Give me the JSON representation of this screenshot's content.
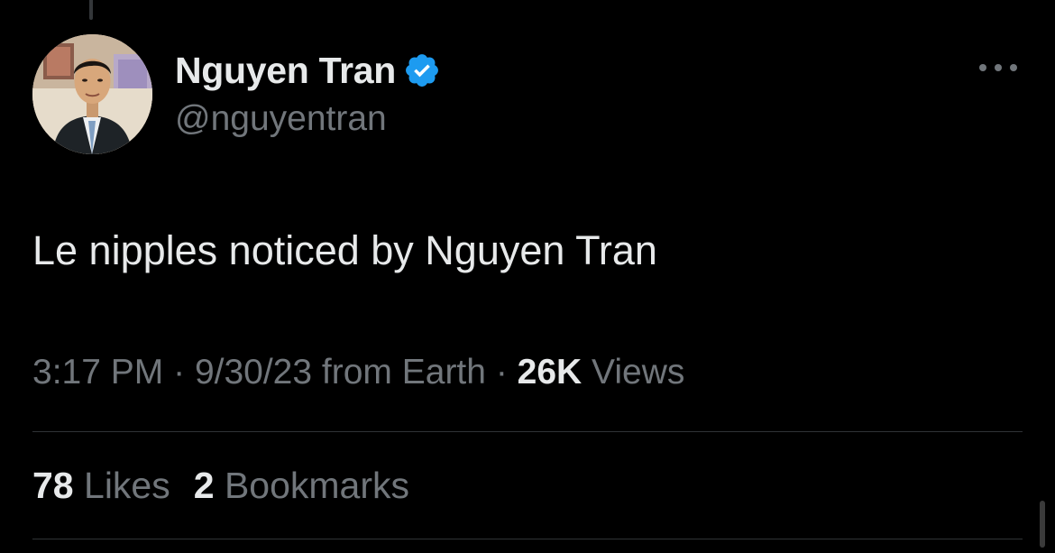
{
  "author": {
    "display_name": "Nguyen Tran",
    "handle": "@nguyentran",
    "verified": true,
    "verified_badge_color": "#1d9bf0"
  },
  "tweet": {
    "text": "Le nipples noticed by Nguyen Tran"
  },
  "meta": {
    "time": "3:17 PM",
    "separator": "·",
    "date": "9/30/23",
    "source": "from Earth",
    "views_count": "26K",
    "views_label": "Views"
  },
  "stats": {
    "likes_count": "78",
    "likes_label": "Likes",
    "bookmarks_count": "2",
    "bookmarks_label": "Bookmarks"
  },
  "icons": {
    "more": "more-horizontal-icon",
    "verified": "verified-badge-icon"
  },
  "colors": {
    "background": "#000000",
    "primary_text": "#e7e9ea",
    "secondary_text": "#71767b",
    "divider": "#2f3336"
  }
}
